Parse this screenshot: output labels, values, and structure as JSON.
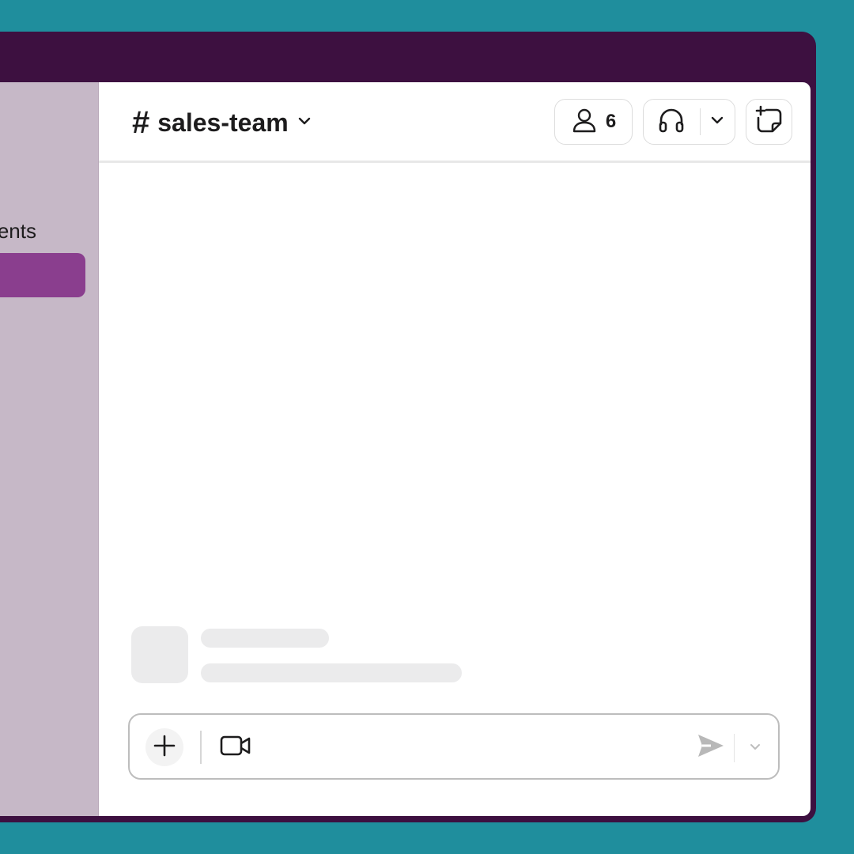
{
  "sidebar": {
    "partial_label": "ents"
  },
  "header": {
    "channel_hash": "#",
    "channel_name": "sales-team",
    "member_count": "6"
  },
  "colors": {
    "background": "#1f8e9d",
    "app_frame": "#3d1040",
    "sidebar": "#c6b8c7",
    "sidebar_active": "#8a3e8e"
  },
  "icons": {
    "channel_dropdown": "chevron-down-icon",
    "members": "person-icon",
    "huddle": "headphones-icon",
    "huddle_dropdown": "chevron-down-icon",
    "canvas": "new-canvas-icon",
    "attach": "plus-icon",
    "video": "video-camera-icon",
    "send": "send-icon",
    "send_options": "chevron-down-icon"
  }
}
